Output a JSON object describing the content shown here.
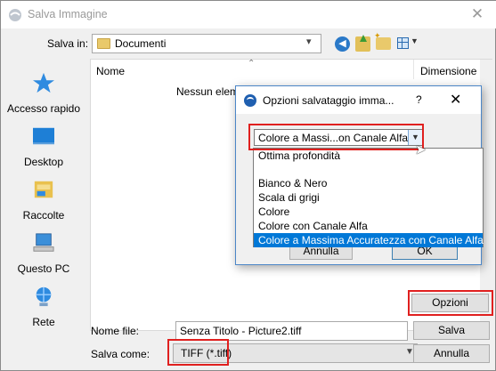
{
  "window": {
    "title": "Salva Immagine",
    "close_glyph": "✕"
  },
  "toolbar": {
    "save_in_label": "Salva in:",
    "save_in_value": "Documenti",
    "icons": [
      "back-icon",
      "up-folder-icon",
      "new-folder-icon",
      "view-menu-icon"
    ]
  },
  "places": [
    {
      "label": "Accesso rapido",
      "icon": "quick-access-icon"
    },
    {
      "label": "Desktop",
      "icon": "desktop-icon"
    },
    {
      "label": "Raccolte",
      "icon": "libraries-icon"
    },
    {
      "label": "Questo PC",
      "icon": "computer-icon"
    },
    {
      "label": "Rete",
      "icon": "network-icon"
    }
  ],
  "file_list": {
    "columns": [
      "Nome",
      "Dimensione"
    ],
    "empty_message": "Nessun elem"
  },
  "bottom": {
    "filename_label": "Nome file:",
    "filename_value": "Senza Titolo - Picture2.tiff",
    "savetype_label": "Salva come:",
    "savetype_value": "TIFF (*.tiff)",
    "save_button": "Salva",
    "cancel_button": "Annulla",
    "options_button": "Opzioni"
  },
  "dialog": {
    "title": "Opzioni salvataggio imma...",
    "help": "?",
    "close": "✕",
    "depth_selected": "Colore a Massi...on Canale Alfa",
    "cancel": "Annulla",
    "ok": "OK",
    "options": [
      "Ottima profondità",
      "",
      "Bianco & Nero",
      "Scala di grigi",
      "Colore",
      "Colore con Canale Alfa",
      "Colore a Massima Accuratezza con Canale Alfa"
    ],
    "selected_index": 6
  },
  "colors": {
    "highlight": "#e0201f",
    "selection": "#0078d7",
    "accent": "#2a79c8"
  }
}
